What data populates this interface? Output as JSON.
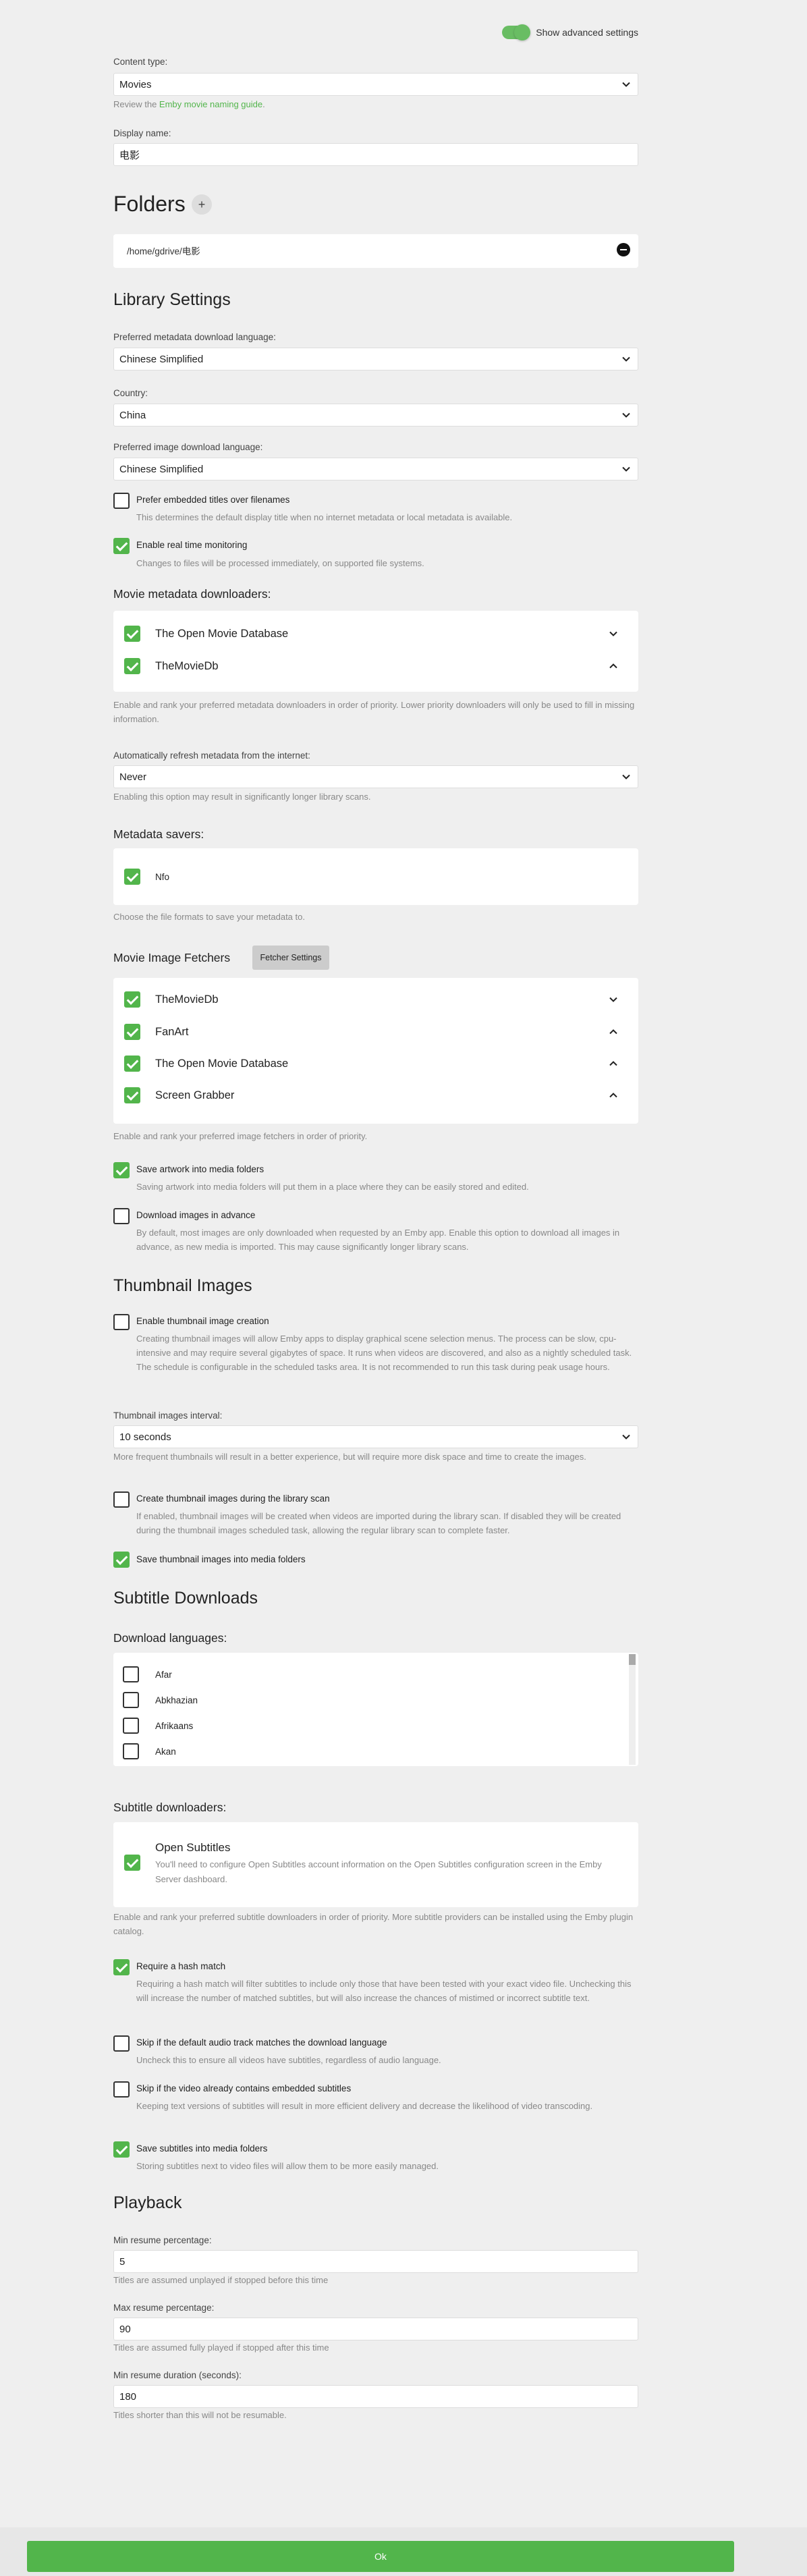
{
  "advanced": {
    "label": "Show advanced settings",
    "enabled": true
  },
  "content_type": {
    "label": "Content type:",
    "value": "Movies",
    "help_prefix": "Review the ",
    "help_link": "Emby movie naming guide",
    "help_suffix": "."
  },
  "display_name": {
    "label": "Display name:",
    "value": "电影"
  },
  "folders": {
    "title": "Folders",
    "add_symbol": "+",
    "items": [
      "/home/gdrive/电影"
    ]
  },
  "library_settings": {
    "title": "Library Settings",
    "metadata_language": {
      "label": "Preferred metadata download language:",
      "value": "Chinese Simplified"
    },
    "country": {
      "label": "Country:",
      "value": "China"
    },
    "image_language": {
      "label": "Preferred image download language:",
      "value": "Chinese Simplified"
    },
    "prefer_embedded": {
      "label": "Prefer embedded titles over filenames",
      "help": "This determines the default display title when no internet metadata or local metadata is available.",
      "checked": false
    },
    "realtime": {
      "label": "Enable real time monitoring",
      "help": "Changes to files will be processed immediately, on supported file systems.",
      "checked": true
    }
  },
  "metadata_downloaders": {
    "title": "Movie metadata downloaders:",
    "items": [
      {
        "name": "The Open Movie Database",
        "checked": true,
        "arrow": "down"
      },
      {
        "name": "TheMovieDb",
        "checked": true,
        "arrow": "up"
      }
    ],
    "help": "Enable and rank your preferred metadata downloaders in order of priority. Lower priority downloaders will only be used to fill in missing information."
  },
  "refresh": {
    "label": "Automatically refresh metadata from the internet:",
    "value": "Never",
    "help": "Enabling this option may result in significantly longer library scans."
  },
  "metadata_savers": {
    "title": "Metadata savers:",
    "items": [
      {
        "name": "Nfo",
        "checked": true
      }
    ],
    "help": "Choose the file formats to save your metadata to."
  },
  "image_fetchers": {
    "title": "Movie Image Fetchers",
    "settings_button": "Fetcher Settings",
    "items": [
      {
        "name": "TheMovieDb",
        "checked": true,
        "arrow": "down"
      },
      {
        "name": "FanArt",
        "checked": true,
        "arrow": "up"
      },
      {
        "name": "The Open Movie Database",
        "checked": true,
        "arrow": "up"
      },
      {
        "name": "Screen Grabber",
        "checked": true,
        "arrow": "up"
      }
    ],
    "help": "Enable and rank your preferred image fetchers in order of priority."
  },
  "save_artwork": {
    "label": "Save artwork into media folders",
    "help": "Saving artwork into media folders will put them in a place where they can be easily stored and edited.",
    "checked": true
  },
  "download_images": {
    "label": "Download images in advance",
    "help": "By default, most images are only downloaded when requested by an Emby app. Enable this option to download all images in advance, as new media is imported. This may cause significantly longer library scans.",
    "checked": false
  },
  "thumbnails": {
    "title": "Thumbnail Images",
    "enable": {
      "label": "Enable thumbnail image creation",
      "help": "Creating thumbnail images will allow Emby apps to display graphical scene selection menus. The process can be slow, cpu-intensive and may require several gigabytes of space. It runs when videos are discovered, and also as a nightly scheduled task. The schedule is configurable in the scheduled tasks area. It is not recommended to run this task during peak usage hours.",
      "checked": false
    },
    "interval": {
      "label": "Thumbnail images interval:",
      "value": "10 seconds",
      "help": "More frequent thumbnails will result in a better experience, but will require more disk space and time to create the images."
    },
    "during_scan": {
      "label": "Create thumbnail images during the library scan",
      "help": "If enabled, thumbnail images will be created when videos are imported during the library scan. If disabled they will be created during the thumbnail images scheduled task, allowing the regular library scan to complete faster.",
      "checked": false
    },
    "save_into_folders": {
      "label": "Save thumbnail images into media folders",
      "checked": true
    }
  },
  "subtitles": {
    "title": "Subtitle Downloads",
    "languages_title": "Download languages:",
    "languages": [
      {
        "name": "Afar",
        "checked": false
      },
      {
        "name": "Abkhazian",
        "checked": false
      },
      {
        "name": "Afrikaans",
        "checked": false
      },
      {
        "name": "Akan",
        "checked": false
      }
    ],
    "downloaders_title": "Subtitle downloaders:",
    "downloader": {
      "name": "Open Subtitles",
      "help": "You'll need to configure Open Subtitles account information on the Open Subtitles configuration screen in the Emby Server dashboard.",
      "checked": true
    },
    "downloaders_help": "Enable and rank your preferred subtitle downloaders in order of priority. More subtitle providers can be installed using the Emby plugin catalog.",
    "hash": {
      "label": "Require a hash match",
      "help": "Requiring a hash match will filter subtitles to include only those that have been tested with your exact video file. Unchecking this will increase the number of matched subtitles, but will also increase the chances of mistimed or incorrect subtitle text.",
      "checked": true
    },
    "skip_audio": {
      "label": "Skip if the default audio track matches the download language",
      "help": "Uncheck this to ensure all videos have subtitles, regardless of audio language.",
      "checked": false
    },
    "skip_embedded": {
      "label": "Skip if the video already contains embedded subtitles",
      "help": "Keeping text versions of subtitles will result in more efficient delivery and decrease the likelihood of video transcoding.",
      "checked": false
    },
    "save_into_folders": {
      "label": "Save subtitles into media folders",
      "help": "Storing subtitles next to video files will allow them to be more easily managed.",
      "checked": true
    }
  },
  "playback": {
    "title": "Playback",
    "min_resume": {
      "label": "Min resume percentage:",
      "value": "5",
      "help": "Titles are assumed unplayed if stopped before this time"
    },
    "max_resume": {
      "label": "Max resume percentage:",
      "value": "90",
      "help": "Titles are assumed fully played if stopped after this time"
    },
    "min_duration": {
      "label": "Min resume duration (seconds):",
      "value": "180",
      "help": "Titles shorter than this will not be resumable."
    }
  },
  "ok_button": "Ok"
}
